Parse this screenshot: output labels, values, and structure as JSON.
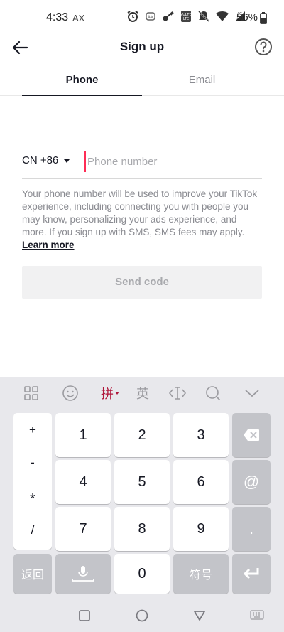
{
  "status_bar": {
    "time": "4:33",
    "carrier_tag": "AX",
    "network": "4G",
    "battery": "56%"
  },
  "header": {
    "title": "Sign up"
  },
  "tabs": [
    {
      "label": "Phone",
      "active": true
    },
    {
      "label": "Email",
      "active": false
    }
  ],
  "form": {
    "country_code": "CN +86",
    "phone_placeholder": "Phone number",
    "phone_value": "",
    "info_text": "Your phone number will be used to improve your TikTok experience, including connecting you with people you may know, personalizing your ads experience, and more. If you sign up with SMS, SMS fees may apply.",
    "learn_more": "Learn more",
    "send_button": "Send code"
  },
  "keyboard": {
    "toolbar": {
      "pinyin": "拼",
      "english": "英"
    },
    "symbols": [
      "+",
      "-",
      "*",
      "/"
    ],
    "digits": [
      "1",
      "2",
      "3",
      "4",
      "5",
      "6",
      "7",
      "8",
      "9",
      "0"
    ],
    "side_keys": {
      "at": "@",
      "dot": "."
    },
    "bottom_row": {
      "back": "返回",
      "symbols": "符号"
    }
  },
  "colors": {
    "accent": "#fe2c55",
    "pinyin_active": "#b0163a",
    "text_primary": "#161823",
    "text_secondary": "#8a8b91",
    "button_disabled_bg": "#f1f1f2"
  }
}
